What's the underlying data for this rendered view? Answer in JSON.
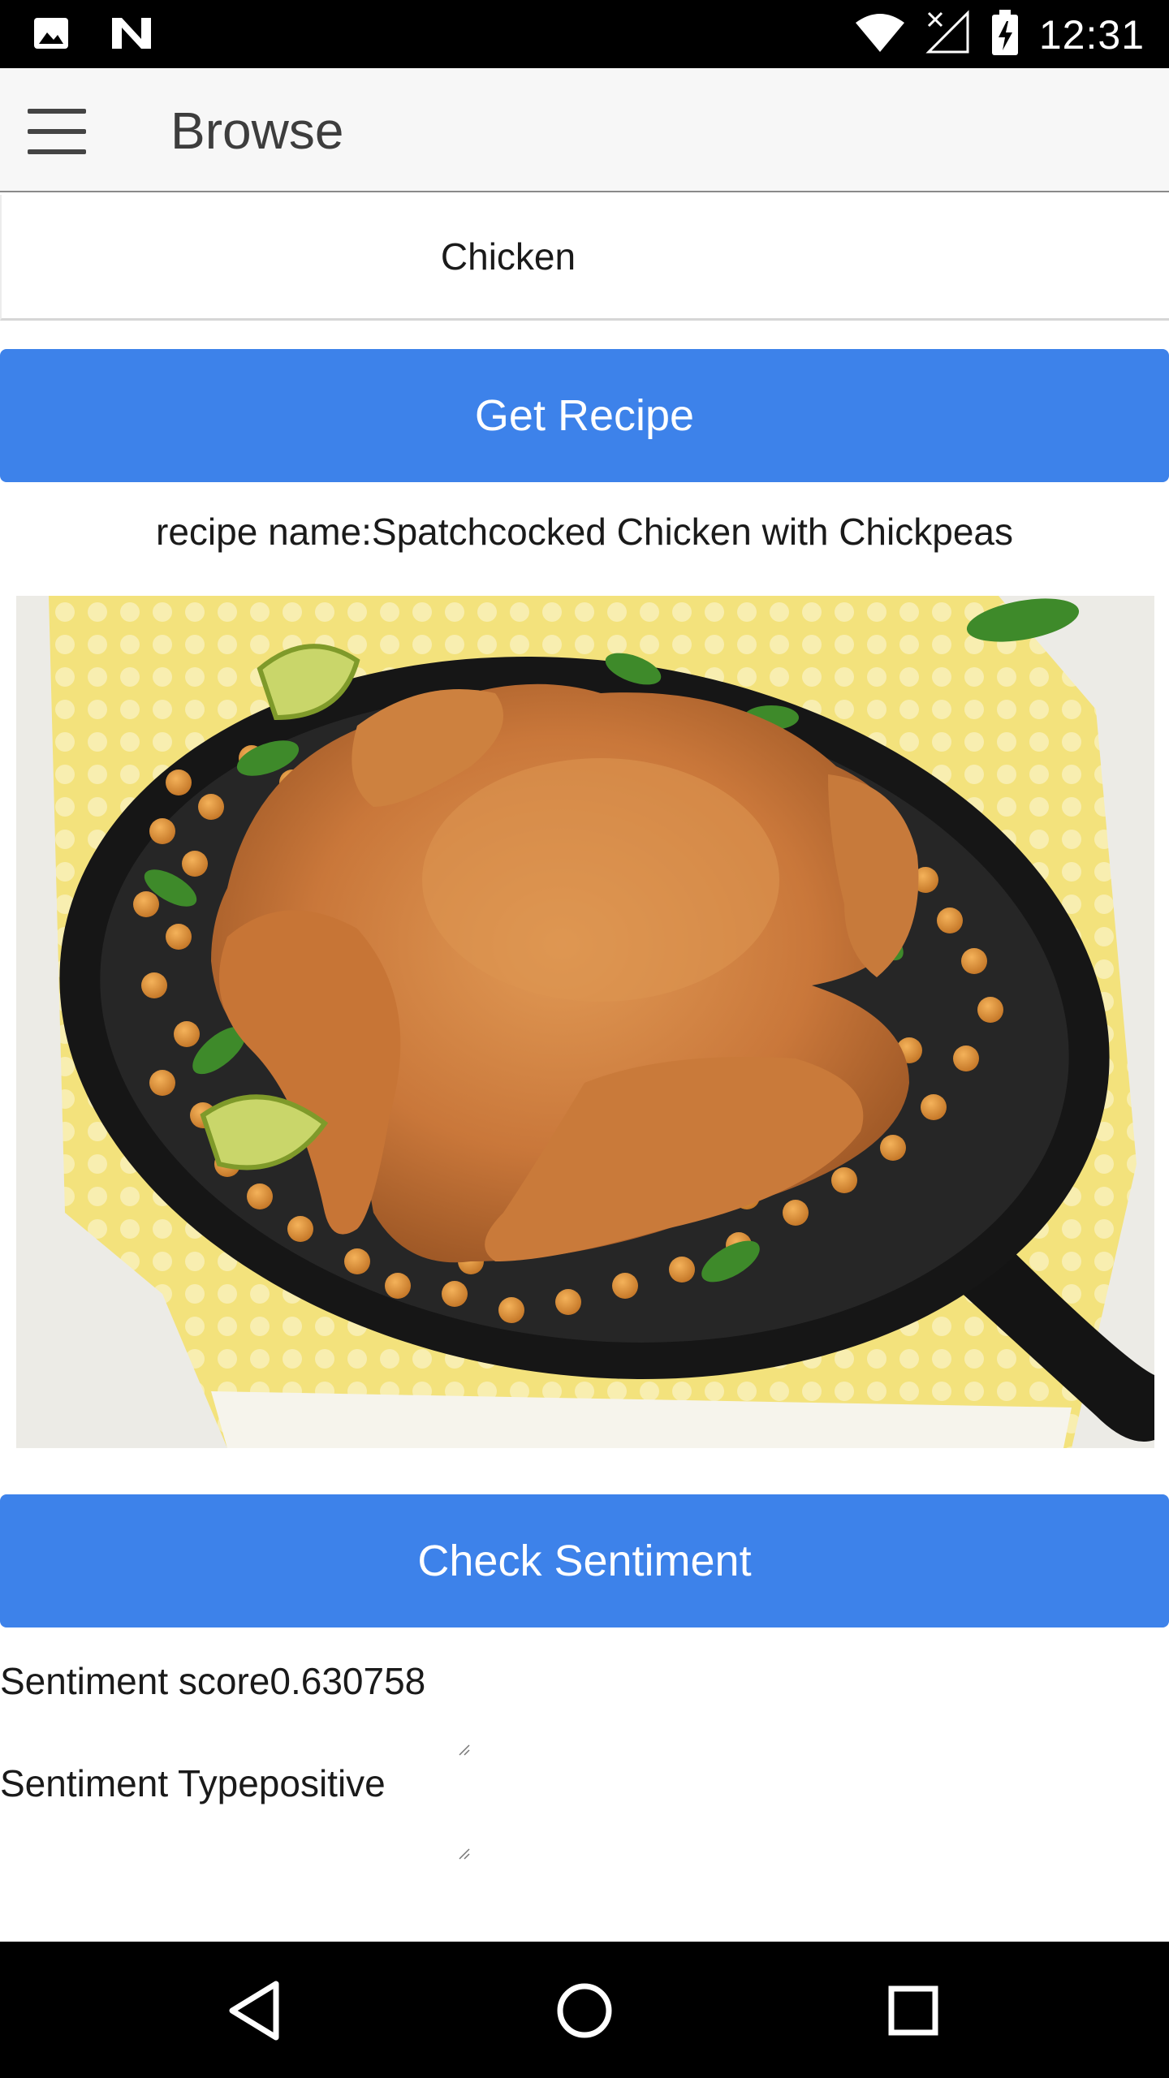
{
  "status_bar": {
    "time": "12:31",
    "icons": [
      "image-icon",
      "n-icon",
      "wifi-icon",
      "no-signal-icon",
      "battery-charging-icon"
    ]
  },
  "app_bar": {
    "title": "Browse",
    "menu_icon": "hamburger-menu-icon"
  },
  "search": {
    "value": "Chicken"
  },
  "get_recipe_button": "Get Recipe",
  "recipe": {
    "name": "recipe name:Spatchcocked Chicken with Chickpeas",
    "image_alt": "Spatchcocked chicken with chickpeas in a cast-iron skillet"
  },
  "check_sentiment_button": "Check Sentiment",
  "sentiment": {
    "score_text": "Sentiment score0.630758",
    "type_text": "Sentiment Typepositive"
  },
  "nav_bar": {
    "icons": [
      "back-icon",
      "home-icon",
      "recents-icon"
    ]
  },
  "colors": {
    "accent": "#3d82ea",
    "app_bar": "#f7f7f7",
    "system_bars": "#000000"
  }
}
